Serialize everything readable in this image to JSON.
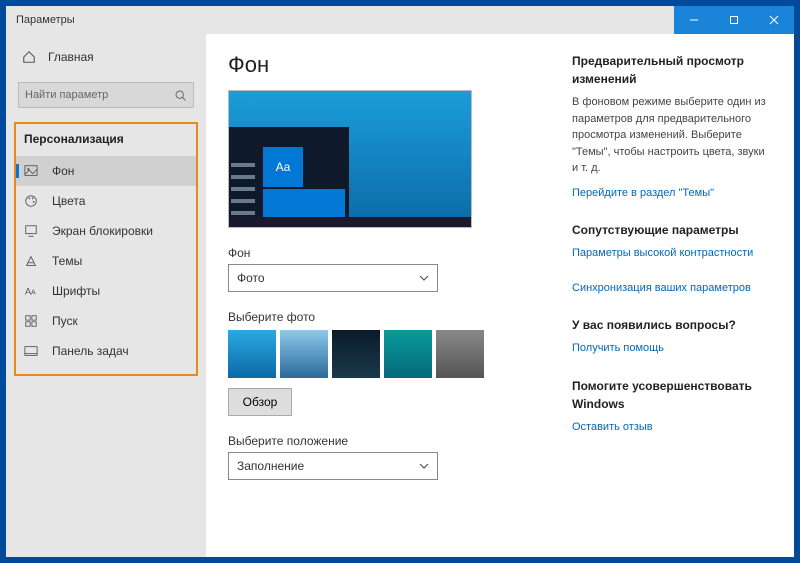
{
  "window": {
    "title": "Параметры"
  },
  "sidebar": {
    "home": "Главная",
    "search_placeholder": "Найти параметр",
    "section": "Персонализация",
    "items": [
      {
        "label": "Фон",
        "active": true
      },
      {
        "label": "Цвета"
      },
      {
        "label": "Экран блокировки"
      },
      {
        "label": "Темы"
      },
      {
        "label": "Шрифты"
      },
      {
        "label": "Пуск"
      },
      {
        "label": "Панель задач"
      }
    ]
  },
  "main": {
    "heading": "Фон",
    "preview_tile_text": "Aa",
    "background_label": "Фон",
    "background_value": "Фото",
    "choose_photo_label": "Выберите фото",
    "browse": "Обзор",
    "fit_label": "Выберите положение",
    "fit_value": "Заполнение"
  },
  "right": {
    "preview_heading": "Предварительный просмотр изменений",
    "preview_text": "В фоновом режиме выберите один из параметров для предварительного просмотра изменений. Выберите \"Темы\", чтобы настроить цвета, звуки и т. д.",
    "preview_link": "Перейдите в раздел \"Темы\"",
    "related_heading": "Сопутствующие параметры",
    "related_link1": "Параметры высокой контрастности",
    "related_link2": "Синхронизация ваших параметров",
    "questions_heading": "У вас появились вопросы?",
    "questions_link": "Получить помощь",
    "improve_heading": "Помогите усовершенствовать Windows",
    "improve_link": "Оставить отзыв"
  }
}
